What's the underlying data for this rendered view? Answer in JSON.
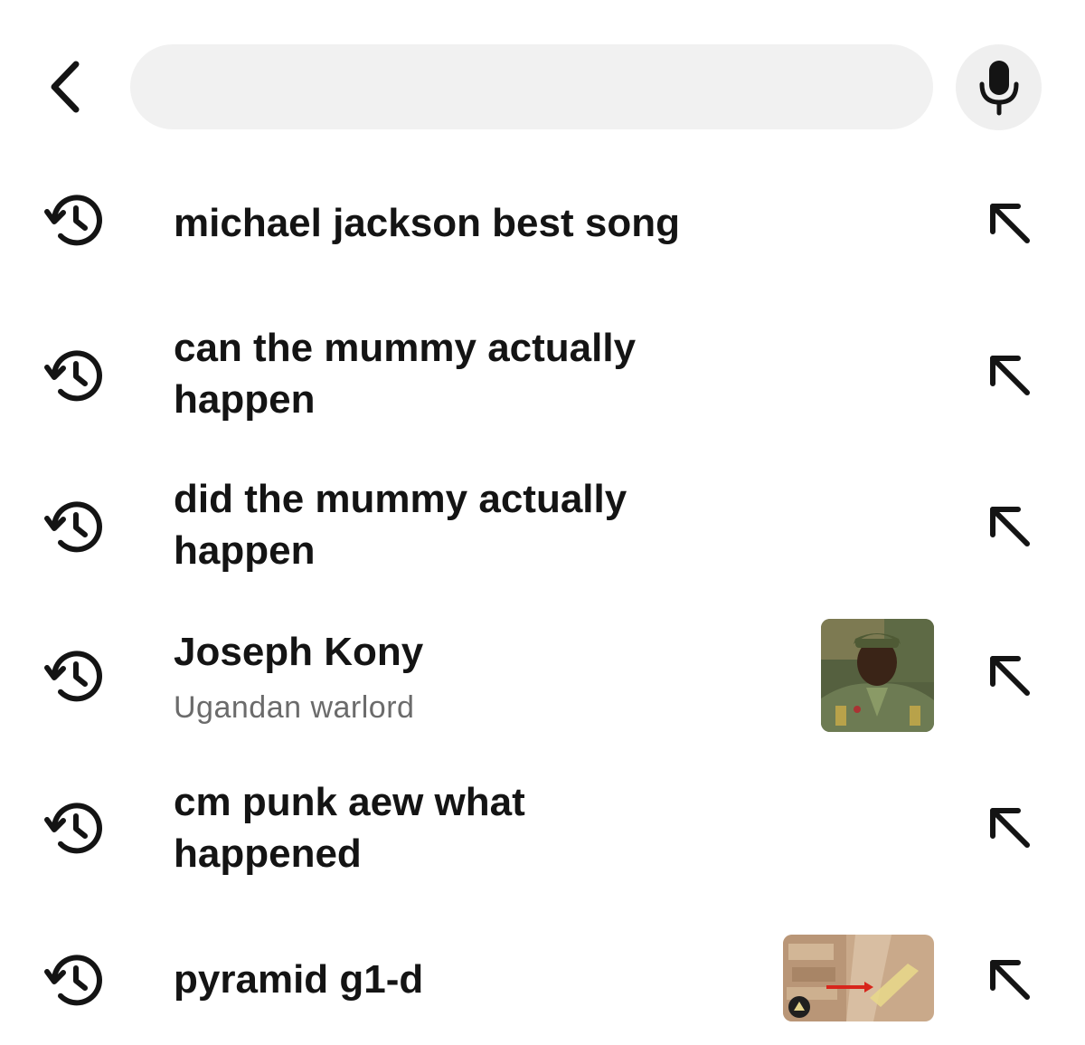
{
  "search": {
    "value": "",
    "placeholder": ""
  },
  "icons": {
    "back": "chevron-left-icon",
    "mic": "microphone-icon",
    "history": "history-clock-icon",
    "fill": "arrow-up-left-icon"
  },
  "colors": {
    "text": "#141414",
    "secondary_text": "#6b6b6b",
    "search_bg": "#f1f1f1",
    "mic_bg": "#efefef"
  },
  "recent_searches": [
    {
      "query": "michael jackson best song"
    },
    {
      "query": "can the mummy actually\nhappen"
    },
    {
      "query": "did the mummy actually\nhappen"
    },
    {
      "query": "Joseph Kony",
      "subtitle": "Ugandan warlord"
    },
    {
      "query": "cm punk aew what\nhappened"
    },
    {
      "query": "pyramid g1-d"
    }
  ]
}
